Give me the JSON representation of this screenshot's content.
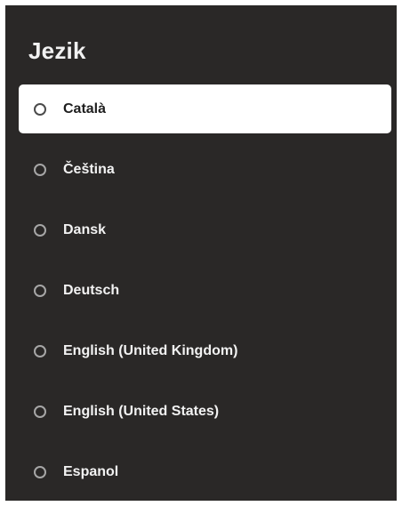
{
  "dialog": {
    "title": "Jezik",
    "items": [
      {
        "label": "Català",
        "focused": true
      },
      {
        "label": "Čeština",
        "focused": false
      },
      {
        "label": "Dansk",
        "focused": false
      },
      {
        "label": "Deutsch",
        "focused": false
      },
      {
        "label": "English (United Kingdom)",
        "focused": false
      },
      {
        "label": "English (United States)",
        "focused": false
      },
      {
        "label": "Espanol",
        "focused": false
      }
    ]
  },
  "colors": {
    "panel_background": "#2a2827",
    "focused_item_background": "#ffffff",
    "text": "#f2f2f2",
    "radio_border": "#a6a6a6"
  }
}
